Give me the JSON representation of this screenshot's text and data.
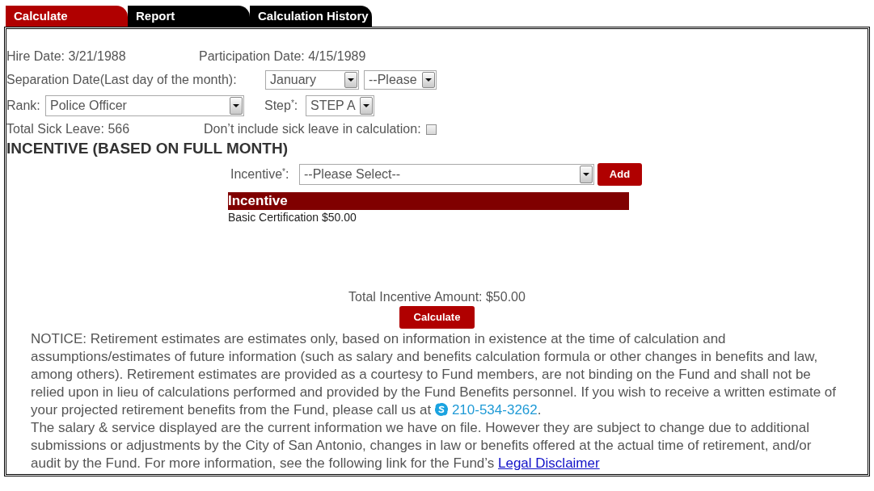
{
  "tabs": [
    {
      "label": "Calculate",
      "selected": true
    },
    {
      "label": "Report",
      "selected": false
    },
    {
      "label": "Calculation History",
      "selected": false
    }
  ],
  "member_info": {
    "hire_date": "Hire Date: 3/21/1988",
    "participation_date": "Participation Date: 4/15/1989"
  },
  "separation_date": {
    "label": "Separation Date(Last day of the month):",
    "month": "January",
    "year": "--Please"
  },
  "rank": {
    "label": "Rank:",
    "value": "Police Officer"
  },
  "step": {
    "label": "Step$^{*}$:",
    "value": "STEP A"
  },
  "sick_leave": {
    "total": "Total Sick Leave: 566",
    "exclude_label": "Don’t include sick leave in calculation:",
    "exclude_checked": false
  },
  "incentive": {
    "heading": "INCENTIVE (BASED ON FULL MONTH)",
    "label": "Incentive$^{*}$:",
    "select": "--Please Select--",
    "add_button": "Add",
    "table": {
      "header": "Incentive",
      "rows": [
        "Basic Certification $50.00"
      ]
    },
    "total": "Total Incentive Amount: $50.00"
  },
  "calculate_button": "Calculate",
  "notice": {
    "paragraph_1": "NOTICE: Retirement estimates are estimates only, based on information in existence at the time of calculation and assumptions/estimates of future information (such as salary and benefits calculation formula or other changes in benefits and law, among others). Retirement estimates are provided as a courtesy to Fund members, are not binding on the Fund and shall not be relied upon in lieu of calculations performed and provided by the Fund Benefits personnel. If you wish to receive a written estimate of your projected retirement benefits from the Fund, please call us at",
    "phone_link": "210-534-3262",
    "paragraph_1_end": ".",
    "paragraph_2": "The salary & service displayed are the current information we have on file. However they are subject to change due to additional submissions or adjustments by the City of San Antonio, changes in law or benefits offered at the actual time of retirement, and/or audit by the Fund. For more information, see the following link for the Fund’s",
    "disclaimer_link": "Legal Disclaimer"
  }
}
